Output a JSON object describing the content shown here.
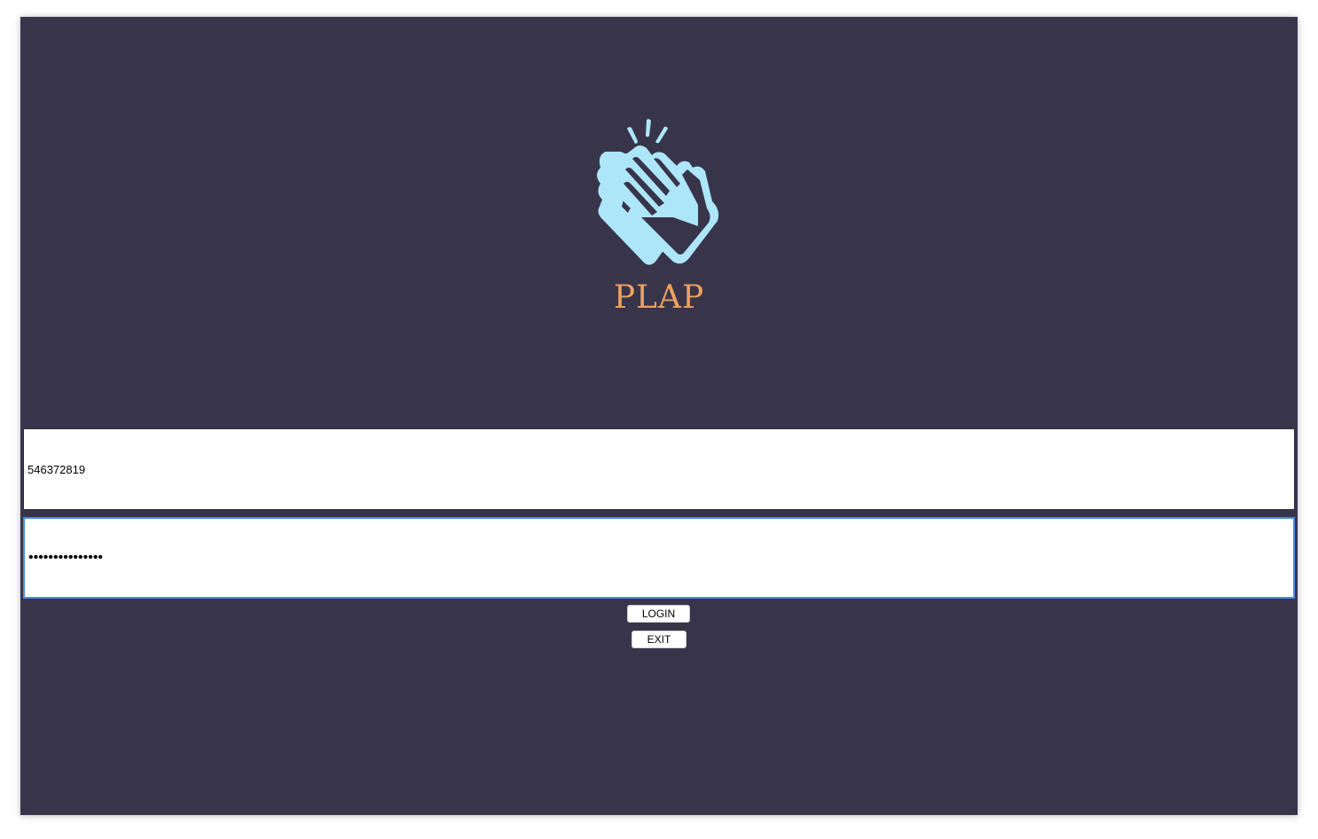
{
  "app": {
    "brand_name": "PLAP",
    "brand_color": "#f0a060",
    "background_color": "#38354b",
    "logo_icon": "clapping-hands-icon",
    "logo_color": "#aee6f9"
  },
  "login_form": {
    "username_value": "546372819",
    "password_value": "123456789012345",
    "login_label": "LOGIN",
    "exit_label": "EXIT"
  }
}
